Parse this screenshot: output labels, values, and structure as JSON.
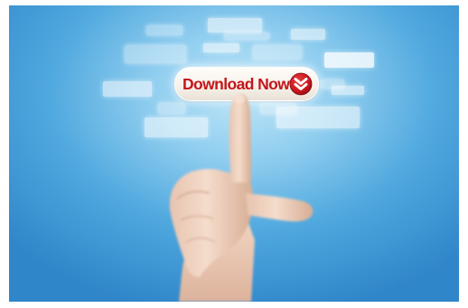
{
  "button": {
    "label": "Download Now",
    "icon": "double-chevron-down-icon",
    "label_color": "#c4161c",
    "icon_color": "#c8161d"
  },
  "background": {
    "accent": "#4fa8de"
  }
}
